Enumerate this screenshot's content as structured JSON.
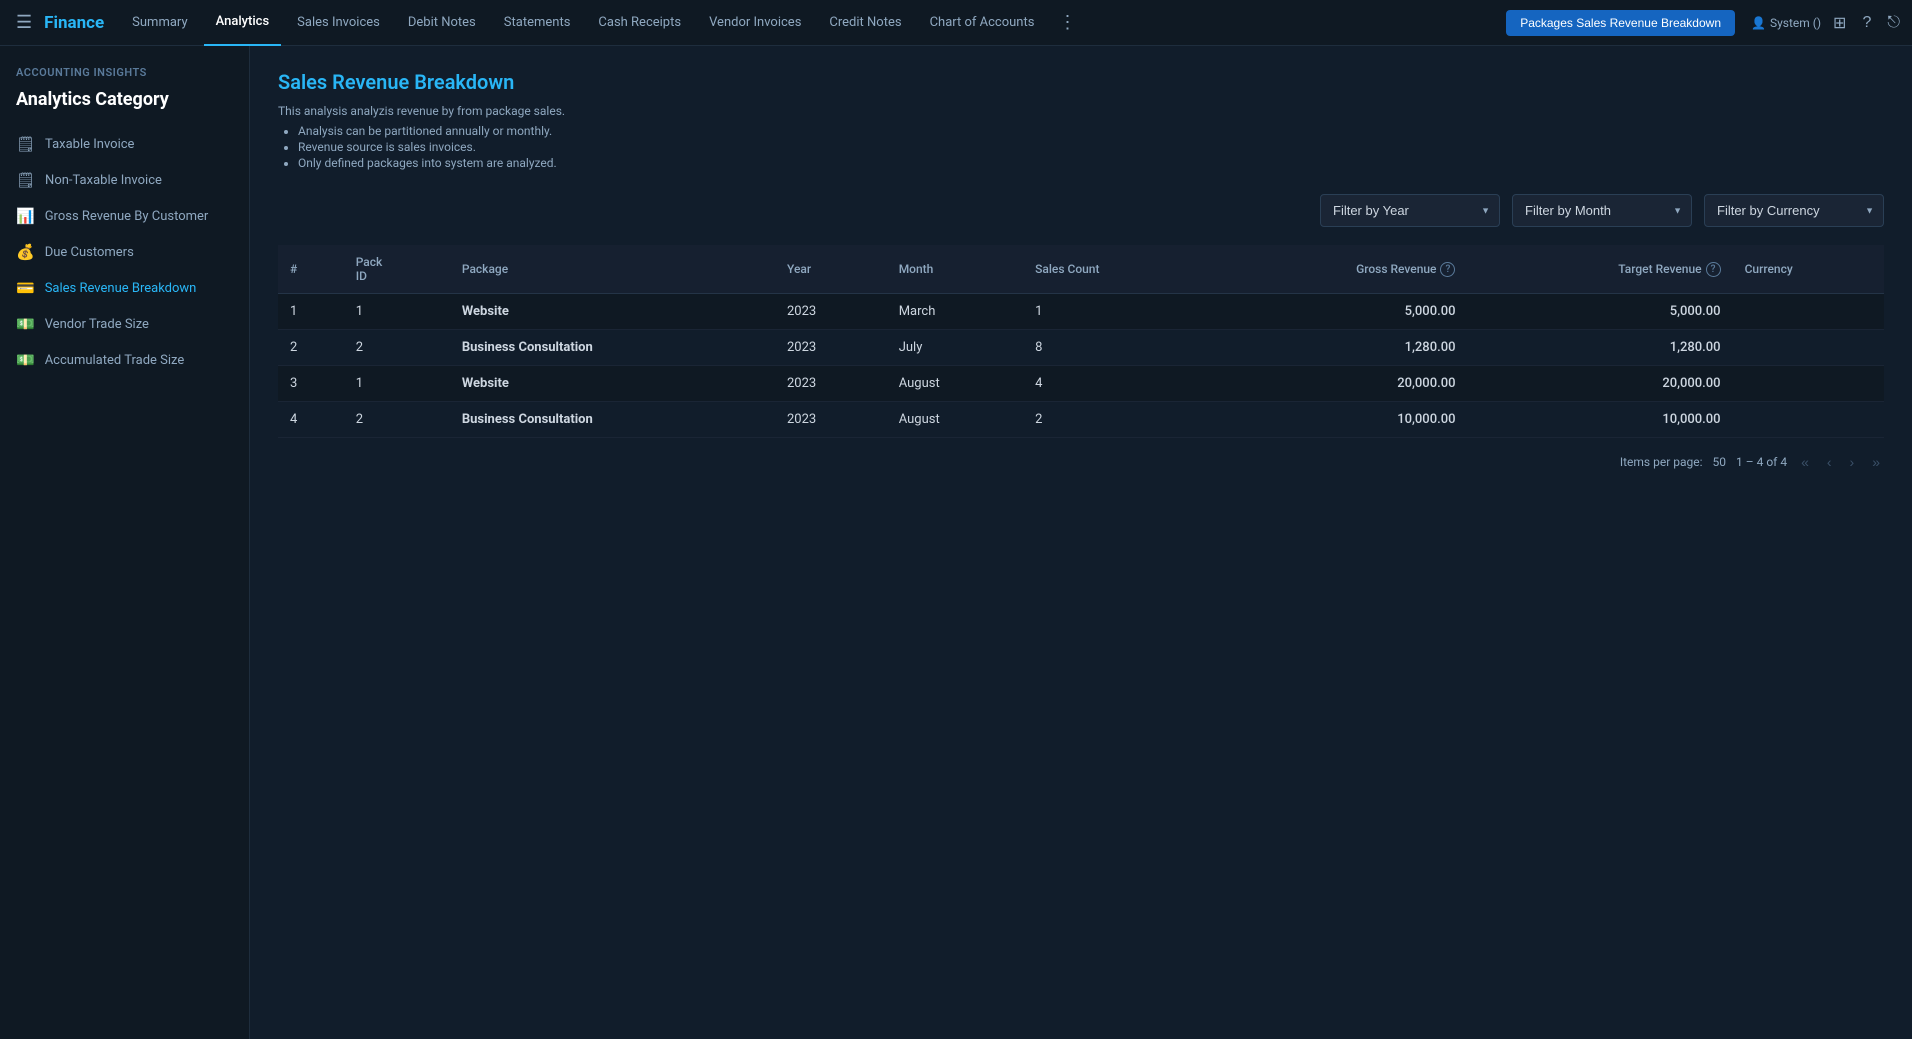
{
  "brand": "Finance",
  "nav": {
    "tabs": [
      {
        "label": "Summary",
        "active": false
      },
      {
        "label": "Analytics",
        "active": true
      },
      {
        "label": "Sales Invoices",
        "active": false
      },
      {
        "label": "Debit Notes",
        "active": false
      },
      {
        "label": "Statements",
        "active": false
      },
      {
        "label": "Cash Receipts",
        "active": false
      },
      {
        "label": "Vendor Invoices",
        "active": false
      },
      {
        "label": "Credit Notes",
        "active": false
      },
      {
        "label": "Chart of Accounts",
        "active": false
      }
    ],
    "cta_button": "Packages Sales Revenue Breakdown",
    "user_label": "System ()"
  },
  "sidebar": {
    "section_label": "Accounting Insights",
    "title": "Analytics Category",
    "items": [
      {
        "label": "Taxable Invoice",
        "icon": "📄",
        "active": false
      },
      {
        "label": "Non-Taxable Invoice",
        "icon": "📄",
        "active": false
      },
      {
        "label": "Gross Revenue By Customer",
        "icon": "📊",
        "active": false
      },
      {
        "label": "Due Customers",
        "icon": "💰",
        "active": false
      },
      {
        "label": "Sales Revenue Breakdown",
        "icon": "💳",
        "active": true
      },
      {
        "label": "Vendor Trade Size",
        "icon": "💵",
        "active": false
      },
      {
        "label": "Accumulated Trade Size",
        "icon": "💵",
        "active": false
      }
    ]
  },
  "main": {
    "page_title": "Sales Revenue Breakdown",
    "description": "This analysis analyzis revenue by from package sales.",
    "bullets": [
      "Analysis can be partitioned annually or monthly.",
      "Revenue source is sales invoices.",
      "Only defined packages into system are analyzed."
    ],
    "filters": {
      "year_label": "Filter by Year",
      "month_label": "Filter by Month",
      "currency_label": "Filter by Currency"
    },
    "table": {
      "columns": [
        "#",
        "Pack ID",
        "Package",
        "Year",
        "Month",
        "Sales Count",
        "Gross Revenue",
        "Target Revenue",
        "Currency"
      ],
      "rows": [
        {
          "num": 1,
          "pack_id": 1,
          "package": "Website",
          "year": 2023,
          "month": "March",
          "sales_count": 1,
          "gross_revenue": "5,000.00",
          "target_revenue": "5,000.00",
          "currency": ""
        },
        {
          "num": 2,
          "pack_id": 2,
          "package": "Business Consultation",
          "year": 2023,
          "month": "July",
          "sales_count": 8,
          "gross_revenue": "1,280.00",
          "target_revenue": "1,280.00",
          "currency": ""
        },
        {
          "num": 3,
          "pack_id": 1,
          "package": "Website",
          "year": 2023,
          "month": "August",
          "sales_count": 4,
          "gross_revenue": "20,000.00",
          "target_revenue": "20,000.00",
          "currency": ""
        },
        {
          "num": 4,
          "pack_id": 2,
          "package": "Business Consultation",
          "year": 2023,
          "month": "August",
          "sales_count": 2,
          "gross_revenue": "10,000.00",
          "target_revenue": "10,000.00",
          "currency": ""
        }
      ]
    },
    "pagination": {
      "items_per_page_label": "Items per page:",
      "items_per_page": 50,
      "range": "1 – 4 of 4"
    }
  }
}
